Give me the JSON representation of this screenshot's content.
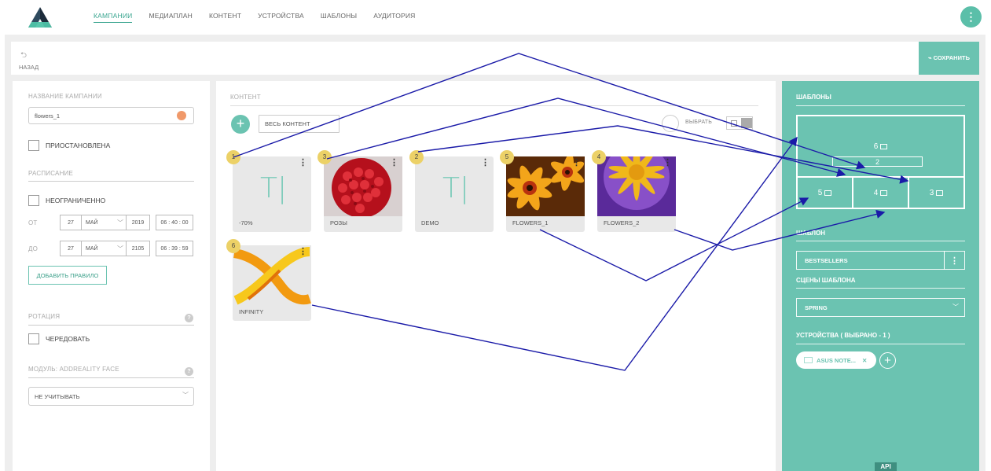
{
  "nav": {
    "items": [
      "КАМПАНИИ",
      "МЕДИАПЛАН",
      "КОНТЕНТ",
      "УСТРОЙСТВА",
      "ШАБЛОНЫ",
      "АУДИТОРИЯ"
    ],
    "active_index": 0
  },
  "header": {
    "menu_glyph": "⋮"
  },
  "toolbar": {
    "back_label": "НАЗАД",
    "save_label": "СОХРАНИТЬ"
  },
  "left": {
    "campaign_name_label": "НАЗВАНИЕ КАМПАНИИ",
    "campaign_name_value": "flowers_1",
    "paused_label": "ПРИОСТАНОВЛЕНА",
    "schedule_label": "РАСПИСАНИЕ",
    "unlimited_label": "НЕОГРАНИЧЕННО",
    "from_label": "ОТ",
    "to_label": "ДО",
    "from": {
      "day": "27",
      "month": "МАЙ",
      "year": "2019",
      "time": "06 : 40 : 00"
    },
    "to": {
      "day": "27",
      "month": "МАЙ",
      "year": "2105",
      "time": "06 : 39 : 59"
    },
    "add_rule_label": "ДОБАВИТЬ ПРАВИЛО",
    "rotation_label": "РОТАЦИЯ",
    "alternate_label": "ЧЕРЕДОВАТЬ",
    "module_label": "МОДУЛЬ: ADDREALITY FACE",
    "module_value": "НЕ УЧИТЫВАТЬ",
    "help_glyph": "?"
  },
  "content": {
    "section_label": "КОНТЕНТ",
    "filter_label": "ВЕСЬ КОНТЕНТ",
    "select_label": "ВЫБРАТЬ",
    "text_tile_glyph": "T|",
    "tile_menu_glyph": "⋮",
    "tiles": [
      {
        "badge": "1",
        "name": "-70%",
        "kind": "text"
      },
      {
        "badge": "3",
        "name": "РОЗЫ",
        "kind": "roses"
      },
      {
        "badge": "2",
        "name": "DEMO",
        "kind": "text"
      },
      {
        "badge": "5",
        "name": "FLOWERS_1",
        "kind": "flower-orange"
      },
      {
        "badge": "4",
        "name": "FLOWERS_2",
        "kind": "flower-purple"
      },
      {
        "badge": "6",
        "name": "INFINITY",
        "kind": "infinity"
      }
    ]
  },
  "right": {
    "templates_label": "ШАБЛОНЫ",
    "zones": {
      "z6": "6",
      "z2": "2",
      "z5": "5",
      "z4": "4",
      "z3": "3"
    },
    "template_label": "ШАБЛОН",
    "template_value": "BESTSELLERS",
    "scenes_label": "СЦЕНЫ ШАБЛОНА",
    "scene_value": "SPRING",
    "devices_label": "УСТРОЙСТВА ( ВЫБРАНО - 1 )",
    "device_chip": "ASUS NOTE...",
    "chip_close_glyph": "✕",
    "add_glyph": "+",
    "footer_api": "API"
  },
  "colors": {
    "accent": "#6bc3b1",
    "badge": "#ecd167",
    "arrows": "#1a1aa8"
  }
}
